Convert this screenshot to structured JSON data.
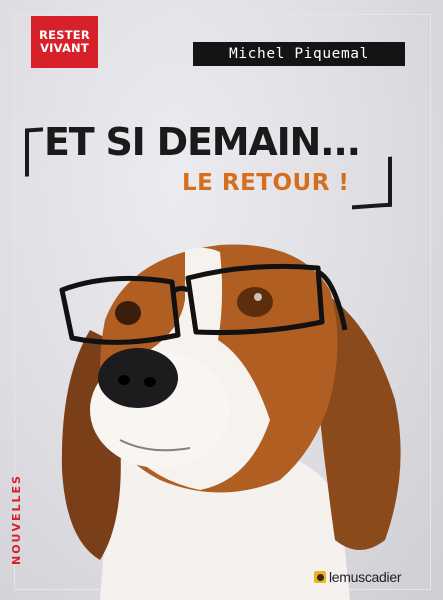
{
  "badge": {
    "line1": "RESTER",
    "line2": "VIVANT"
  },
  "author": "Michel Piquemal",
  "title": {
    "line1": "ET SI DEMAIN...",
    "line2": "LE RETOUR !"
  },
  "genre": "NOUVELLES",
  "publisher": {
    "name": "lemuscadier"
  },
  "colors": {
    "badge_red": "#d7202a",
    "title_orange": "#d56f1e",
    "dark": "#141414"
  }
}
